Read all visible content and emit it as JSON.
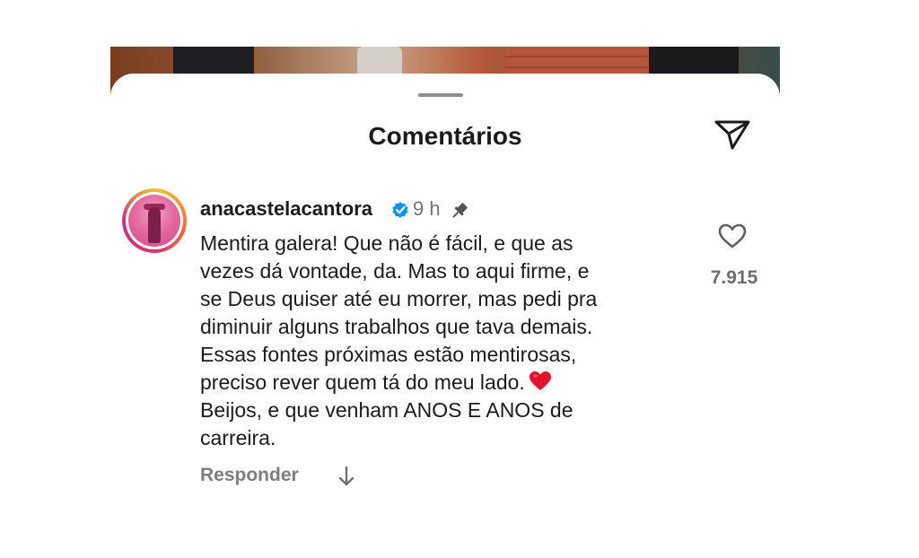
{
  "header": {
    "title": "Comentários"
  },
  "comment": {
    "username": "anacastelacantora",
    "time": "9 h",
    "lines": [
      "Mentira galera! Que não é fácil, e que as",
      "vezes dá vontade, da. Mas to aqui firme, e",
      "se Deus quiser até eu morrer, mas pedi pra",
      "diminuir alguns trabalhos que tava demais.",
      "Essas fontes próximas estão mentirosas,",
      "preciso rever quem tá do meu lado.",
      "Beijos, e que venham ANOS E ANOS de",
      "carreira."
    ],
    "emoji": "red-heart",
    "like_count": "7.915",
    "reply_label": "Responder"
  },
  "icons": {
    "send": "send-icon",
    "verified": "verified-badge-icon",
    "pin": "pin-icon",
    "like": "heart-outline-icon",
    "view_replies": "arrow-down-icon"
  },
  "colors": {
    "verified_blue": "#0095f6",
    "heart_red": "#e0142a",
    "muted_text": "#737373"
  }
}
